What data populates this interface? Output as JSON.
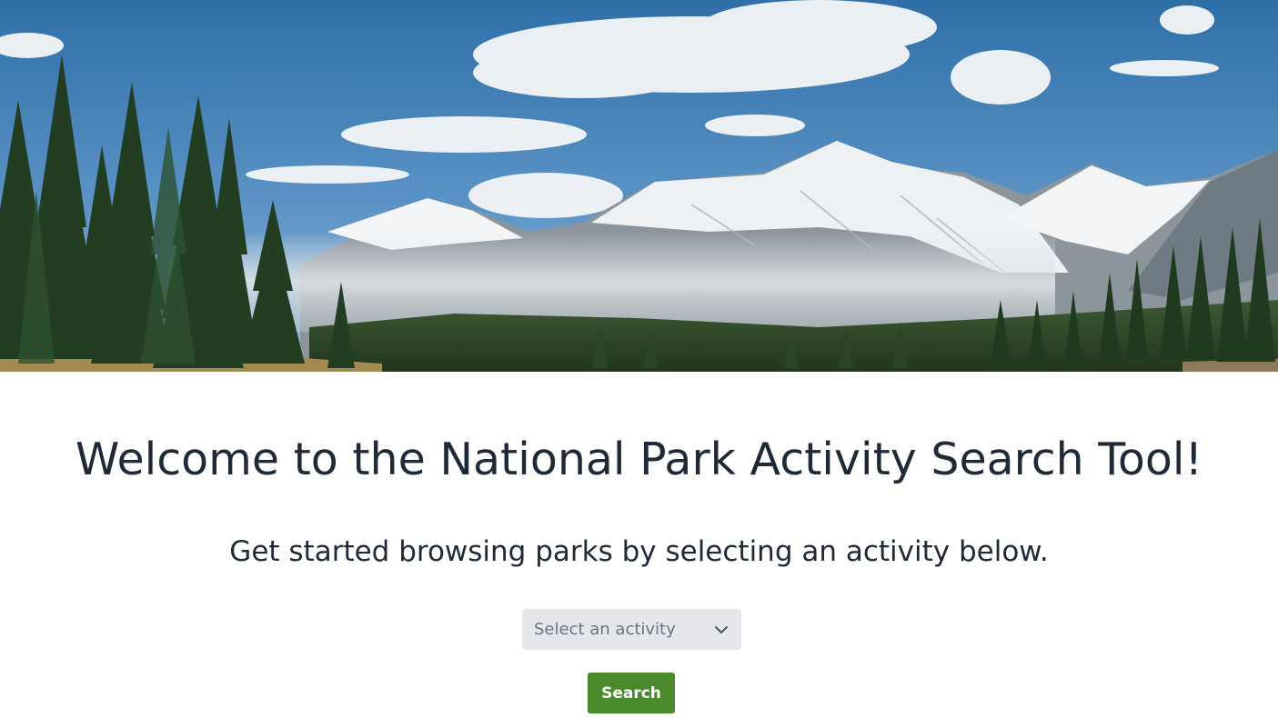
{
  "hero": {
    "image_icon": "mountain-forest-landscape"
  },
  "main": {
    "title": "Welcome to the National Park Activity Search Tool!",
    "subtitle": "Get started browsing parks by selecting an activity below.",
    "activity_select": {
      "placeholder": "Select an activity",
      "icon": "chevron-down-icon"
    },
    "search_button_label": "Search"
  },
  "colors": {
    "button_bg": "#4a8a2a",
    "select_bg": "#e5e7eb",
    "text": "#1f2937"
  }
}
